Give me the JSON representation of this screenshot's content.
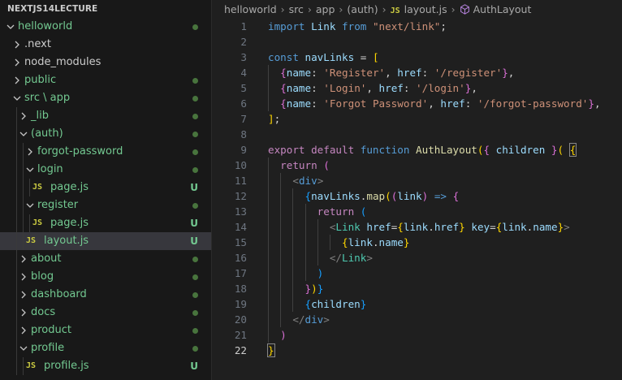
{
  "explorer": {
    "title": "NEXTJS14LECTURE",
    "items": [
      {
        "label": "helloworld",
        "kind": "folder-open",
        "depth": 0,
        "status": "dot"
      },
      {
        "label": ".next",
        "kind": "folder",
        "depth": 1,
        "status": ""
      },
      {
        "label": "node_modules",
        "kind": "folder",
        "depth": 1,
        "status": ""
      },
      {
        "label": "public",
        "kind": "folder",
        "depth": 1,
        "status": "dot"
      },
      {
        "label": "src \\ app",
        "kind": "folder-open",
        "depth": 1,
        "status": "dot"
      },
      {
        "label": "_lib",
        "kind": "folder",
        "depth": 2,
        "status": "dot"
      },
      {
        "label": "(auth)",
        "kind": "folder-open",
        "depth": 2,
        "status": "dot"
      },
      {
        "label": "forgot-password",
        "kind": "folder",
        "depth": 3,
        "status": "dot"
      },
      {
        "label": "login",
        "kind": "folder-open",
        "depth": 3,
        "status": "dot"
      },
      {
        "label": "page.js",
        "kind": "file",
        "depth": 4,
        "status": "U",
        "file_icon": "JS"
      },
      {
        "label": "register",
        "kind": "folder-open",
        "depth": 3,
        "status": "dot"
      },
      {
        "label": "page.js",
        "kind": "file",
        "depth": 4,
        "status": "U",
        "file_icon": "JS"
      },
      {
        "label": "layout.js",
        "kind": "file",
        "depth": 3,
        "status": "U",
        "file_icon": "JS",
        "selected": true
      },
      {
        "label": "about",
        "kind": "folder",
        "depth": 2,
        "status": "dot"
      },
      {
        "label": "blog",
        "kind": "folder",
        "depth": 2,
        "status": "dot"
      },
      {
        "label": "dashboard",
        "kind": "folder",
        "depth": 2,
        "status": "dot"
      },
      {
        "label": "docs",
        "kind": "folder",
        "depth": 2,
        "status": "dot"
      },
      {
        "label": "product",
        "kind": "folder",
        "depth": 2,
        "status": "dot"
      },
      {
        "label": "profile",
        "kind": "folder-open",
        "depth": 2,
        "status": "dot"
      },
      {
        "label": "profile.js",
        "kind": "file",
        "depth": 3,
        "status": "U",
        "file_icon": "JS"
      }
    ]
  },
  "breadcrumb": {
    "items": [
      "helloworld",
      "src",
      "app",
      "(auth)"
    ],
    "file_icon": "JS",
    "file": "layout.js",
    "symbol_icon": "cube-icon",
    "symbol": "AuthLayout"
  },
  "editor": {
    "active_line": 22,
    "lines": [
      {
        "n": "1",
        "indent": 0,
        "tokens": [
          [
            "kw",
            "import"
          ],
          [
            "pun",
            " "
          ],
          [
            "var",
            "Link"
          ],
          [
            "pun",
            " "
          ],
          [
            "kw",
            "from"
          ],
          [
            "pun",
            " "
          ],
          [
            "str",
            "\"next/link\""
          ],
          [
            "pun",
            ";"
          ]
        ]
      },
      {
        "n": "2",
        "indent": 0,
        "tokens": []
      },
      {
        "n": "3",
        "indent": 0,
        "tokens": [
          [
            "kw",
            "const"
          ],
          [
            "pun",
            " "
          ],
          [
            "var",
            "navLinks"
          ],
          [
            "pun",
            " = "
          ],
          [
            "b1",
            "["
          ]
        ]
      },
      {
        "n": "4",
        "indent": 1,
        "tokens": [
          [
            "pun",
            "  "
          ],
          [
            "b2",
            "{"
          ],
          [
            "var",
            "name"
          ],
          [
            "pun",
            ": "
          ],
          [
            "str",
            "'Register'"
          ],
          [
            "pun",
            ", "
          ],
          [
            "var",
            "href"
          ],
          [
            "pun",
            ": "
          ],
          [
            "str",
            "'/register'"
          ],
          [
            "b2",
            "}"
          ],
          [
            "pun",
            ","
          ]
        ]
      },
      {
        "n": "5",
        "indent": 1,
        "tokens": [
          [
            "pun",
            "  "
          ],
          [
            "b2",
            "{"
          ],
          [
            "var",
            "name"
          ],
          [
            "pun",
            ": "
          ],
          [
            "str",
            "'Login'"
          ],
          [
            "pun",
            ", "
          ],
          [
            "var",
            "href"
          ],
          [
            "pun",
            ": "
          ],
          [
            "str",
            "'/login'"
          ],
          [
            "b2",
            "}"
          ],
          [
            "pun",
            ","
          ]
        ]
      },
      {
        "n": "6",
        "indent": 1,
        "tokens": [
          [
            "pun",
            "  "
          ],
          [
            "b2",
            "{"
          ],
          [
            "var",
            "name"
          ],
          [
            "pun",
            ": "
          ],
          [
            "str",
            "'Forgot Password'"
          ],
          [
            "pun",
            ", "
          ],
          [
            "var",
            "href"
          ],
          [
            "pun",
            ": "
          ],
          [
            "str",
            "'/forgot-password'"
          ],
          [
            "b2",
            "}"
          ],
          [
            "pun",
            ","
          ]
        ]
      },
      {
        "n": "7",
        "indent": 0,
        "tokens": [
          [
            "b1",
            "]"
          ],
          [
            "pun",
            ";"
          ]
        ]
      },
      {
        "n": "8",
        "indent": 0,
        "tokens": []
      },
      {
        "n": "9",
        "indent": 0,
        "tokens": [
          [
            "ctl",
            "export"
          ],
          [
            "pun",
            " "
          ],
          [
            "ctl",
            "default"
          ],
          [
            "pun",
            " "
          ],
          [
            "kw",
            "function"
          ],
          [
            "pun",
            " "
          ],
          [
            "fn",
            "AuthLayout"
          ],
          [
            "b1",
            "("
          ],
          [
            "b2",
            "{"
          ],
          [
            "pun",
            " "
          ],
          [
            "var",
            "children"
          ],
          [
            "pun",
            " "
          ],
          [
            "b2",
            "}"
          ],
          [
            "b1",
            "("
          ],
          [
            "pun",
            " "
          ],
          [
            "b1 bm",
            "{"
          ]
        ]
      },
      {
        "n": "10",
        "indent": 1,
        "tokens": [
          [
            "pun",
            "  "
          ],
          [
            "ctl",
            "return"
          ],
          [
            "pun",
            " "
          ],
          [
            "b2",
            "("
          ]
        ]
      },
      {
        "n": "11",
        "indent": 2,
        "tokens": [
          [
            "pun",
            "    "
          ],
          [
            "ang",
            "<"
          ],
          [
            "kw",
            "div"
          ],
          [
            "ang",
            ">"
          ]
        ]
      },
      {
        "n": "12",
        "indent": 3,
        "tokens": [
          [
            "pun",
            "      "
          ],
          [
            "b3",
            "{"
          ],
          [
            "var",
            "navLinks"
          ],
          [
            "pun",
            "."
          ],
          [
            "fn",
            "map"
          ],
          [
            "b1",
            "("
          ],
          [
            "b2",
            "("
          ],
          [
            "var",
            "link"
          ],
          [
            "b2",
            ")"
          ],
          [
            "pun",
            " "
          ],
          [
            "kw",
            "=>"
          ],
          [
            "pun",
            " "
          ],
          [
            "b2",
            "{"
          ]
        ]
      },
      {
        "n": "13",
        "indent": 4,
        "tokens": [
          [
            "pun",
            "        "
          ],
          [
            "ctl",
            "return"
          ],
          [
            "pun",
            " "
          ],
          [
            "b3",
            "("
          ]
        ]
      },
      {
        "n": "14",
        "indent": 5,
        "tokens": [
          [
            "pun",
            "          "
          ],
          [
            "ang",
            "<"
          ],
          [
            "tag",
            "Link"
          ],
          [
            "pun",
            " "
          ],
          [
            "var",
            "href"
          ],
          [
            "pun",
            "="
          ],
          [
            "b1",
            "{"
          ],
          [
            "var",
            "link"
          ],
          [
            "pun",
            "."
          ],
          [
            "var",
            "href"
          ],
          [
            "b1",
            "}"
          ],
          [
            "pun",
            " "
          ],
          [
            "var",
            "key"
          ],
          [
            "pun",
            "="
          ],
          [
            "b1",
            "{"
          ],
          [
            "var",
            "link"
          ],
          [
            "pun",
            "."
          ],
          [
            "var",
            "name"
          ],
          [
            "b1",
            "}"
          ],
          [
            "ang",
            ">"
          ]
        ]
      },
      {
        "n": "15",
        "indent": 6,
        "tokens": [
          [
            "pun",
            "            "
          ],
          [
            "b1",
            "{"
          ],
          [
            "var",
            "link"
          ],
          [
            "pun",
            "."
          ],
          [
            "var",
            "name"
          ],
          [
            "b1",
            "}"
          ]
        ]
      },
      {
        "n": "16",
        "indent": 5,
        "tokens": [
          [
            "pun",
            "          "
          ],
          [
            "ang",
            "</"
          ],
          [
            "tag",
            "Link"
          ],
          [
            "ang",
            ">"
          ]
        ]
      },
      {
        "n": "17",
        "indent": 4,
        "tokens": [
          [
            "pun",
            "        "
          ],
          [
            "b3",
            ")"
          ]
        ]
      },
      {
        "n": "18",
        "indent": 3,
        "tokens": [
          [
            "pun",
            "      "
          ],
          [
            "b2",
            "}"
          ],
          [
            "b1",
            ")"
          ],
          [
            "b3",
            "}"
          ]
        ]
      },
      {
        "n": "19",
        "indent": 3,
        "tokens": [
          [
            "pun",
            "      "
          ],
          [
            "b3",
            "{"
          ],
          [
            "var",
            "children"
          ],
          [
            "b3",
            "}"
          ]
        ]
      },
      {
        "n": "20",
        "indent": 2,
        "tokens": [
          [
            "pun",
            "    "
          ],
          [
            "ang",
            "</"
          ],
          [
            "kw",
            "div"
          ],
          [
            "ang",
            ">"
          ]
        ]
      },
      {
        "n": "21",
        "indent": 1,
        "tokens": [
          [
            "pun",
            "  "
          ],
          [
            "b2",
            ")"
          ]
        ]
      },
      {
        "n": "22",
        "indent": 0,
        "tokens": [
          [
            "b1 bm",
            "}"
          ]
        ]
      }
    ]
  }
}
